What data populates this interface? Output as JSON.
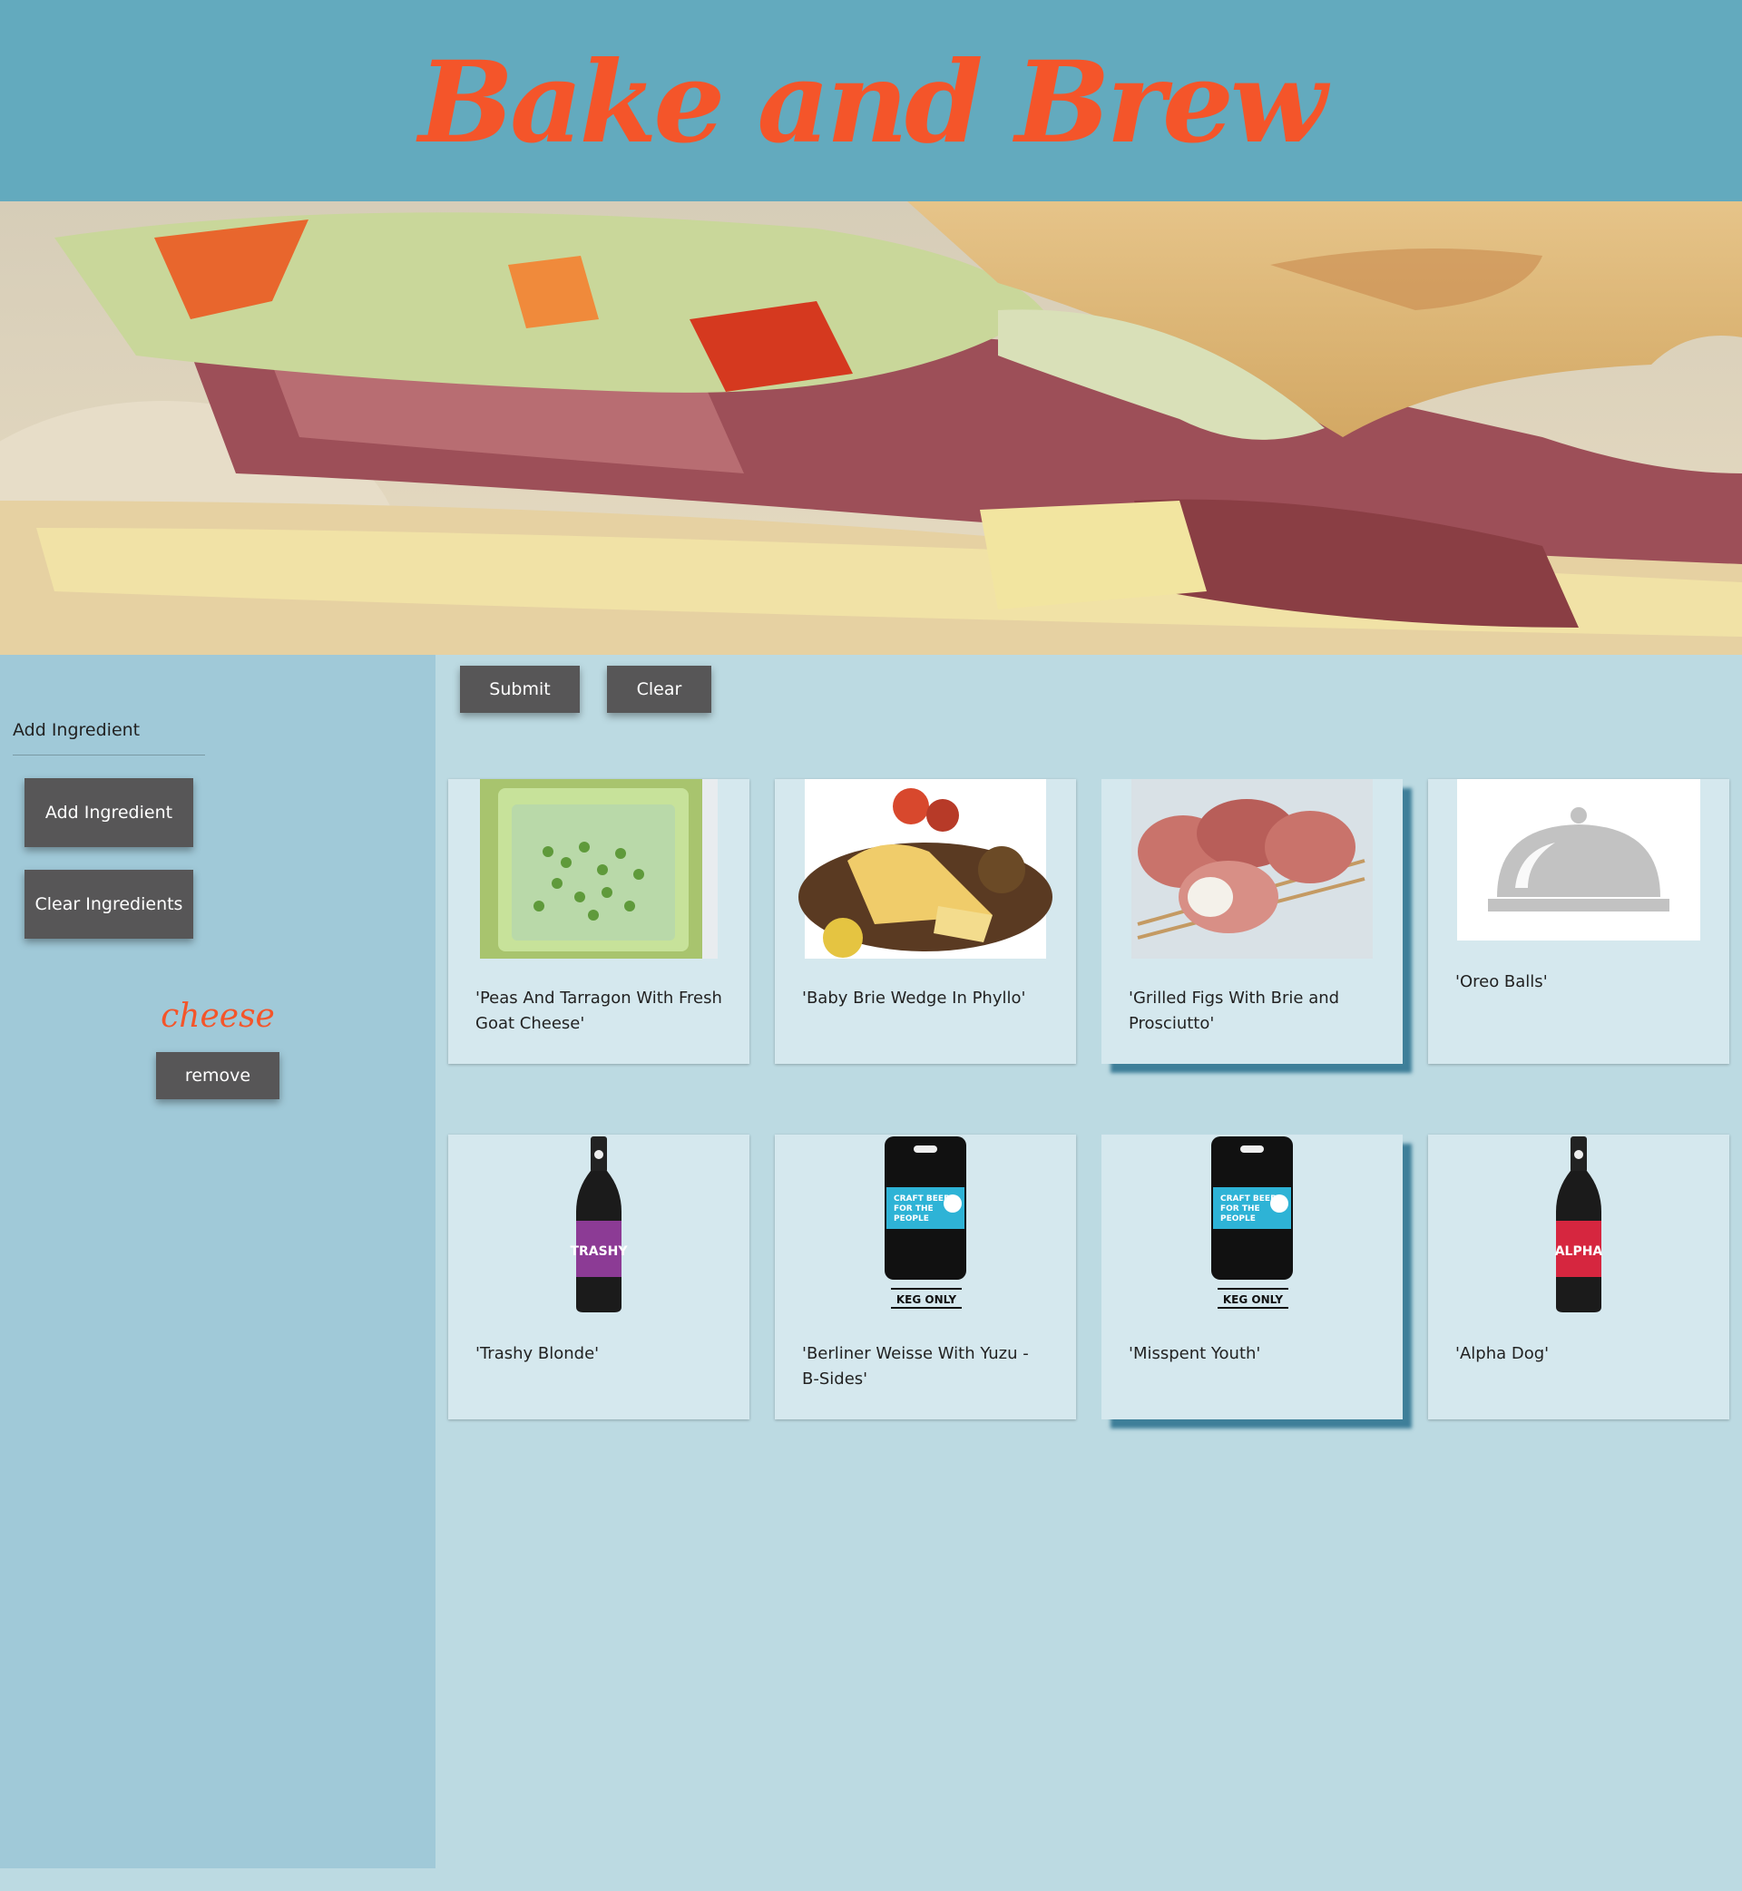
{
  "app": {
    "title": "Bake and Brew"
  },
  "sidebar": {
    "heading": "Add Ingredient",
    "add_button": "Add Ingredient",
    "clear_button": "Clear Ingredients",
    "ingredients": [
      {
        "name": "cheese",
        "remove_label": "remove"
      }
    ]
  },
  "toolbar": {
    "submit_label": "Submit",
    "clear_label": "Clear"
  },
  "recipes": [
    {
      "title": "'Peas And Tarragon With Fresh Goat Cheese'",
      "image": "peas-dish-photo"
    },
    {
      "title": "'Baby Brie Wedge In Phyllo'",
      "image": "brie-phyllo-photo"
    },
    {
      "title": "'Grilled Figs With Brie and Prosciutto'",
      "image": "prosciutto-figs-photo"
    },
    {
      "title": "'Oreo Balls'",
      "image": "serving-cloche-icon"
    }
  ],
  "beers": [
    {
      "title": "'Trashy Blonde'",
      "image": "beer-bottle-purple"
    },
    {
      "title": "'Berliner Weisse With Yuzu - B-Sides'",
      "image": "keg-craft-beer"
    },
    {
      "title": "'Misspent Youth'",
      "image": "keg-craft-beer"
    },
    {
      "title": "'Alpha Dog'",
      "image": "beer-bottle-red"
    }
  ],
  "keg": {
    "line1": "CRAFT BEER",
    "line2": "FOR THE",
    "line3": "PEOPLE",
    "label": "KEG ONLY"
  },
  "colors": {
    "accent": "#f4552a",
    "header_bg": "#63aabe",
    "sidebar_bg": "#a0c9d8",
    "main_bg": "#bcdae2",
    "card_bg": "#d5e8ee",
    "button_bg": "#575657"
  }
}
